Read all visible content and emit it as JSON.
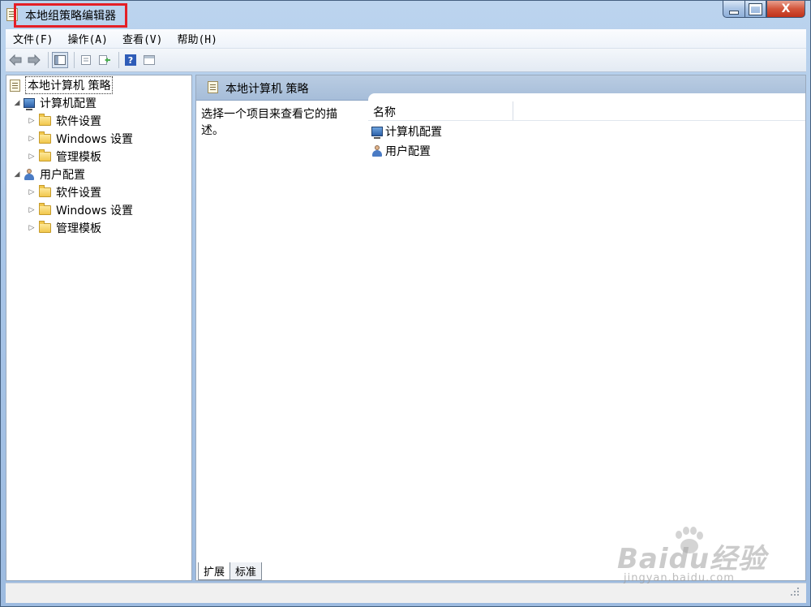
{
  "window": {
    "title": "本地组策略编辑器",
    "caption_buttons": {
      "close_glyph": "X"
    }
  },
  "menu": [
    "文件(F)",
    "操作(A)",
    "查看(V)",
    "帮助(H)"
  ],
  "toolbar": {
    "icons": [
      "back-arrow-icon",
      "forward-arrow-icon",
      "show-hide-tree-icon",
      "properties-icon",
      "export-list-icon",
      "help-icon",
      "show-hide-action-pane-icon"
    ],
    "help_glyph": "?"
  },
  "tree": {
    "root": "本地计算机 策略",
    "computer_config": {
      "label": "计算机配置",
      "children": [
        "软件设置",
        "Windows 设置",
        "管理模板"
      ]
    },
    "user_config": {
      "label": "用户配置",
      "children": [
        "软件设置",
        "Windows 设置",
        "管理模板"
      ]
    }
  },
  "details": {
    "header_title": "本地计算机 策略",
    "description_line1": "选择一个项目来查看它的描",
    "description_line2": "述。",
    "column_name": "名称",
    "items": [
      "计算机配置",
      "用户配置"
    ],
    "tabs": [
      "扩展",
      "标准"
    ],
    "active_tab": "扩展"
  },
  "watermark": {
    "logo": "Baidu经验",
    "url": "jingyan.baidu.com"
  },
  "colors": {
    "title_highlight": "#e41f26",
    "frame": "#a9c6e8",
    "header_band": "#b0c4de",
    "close_button": "#c0321b"
  }
}
